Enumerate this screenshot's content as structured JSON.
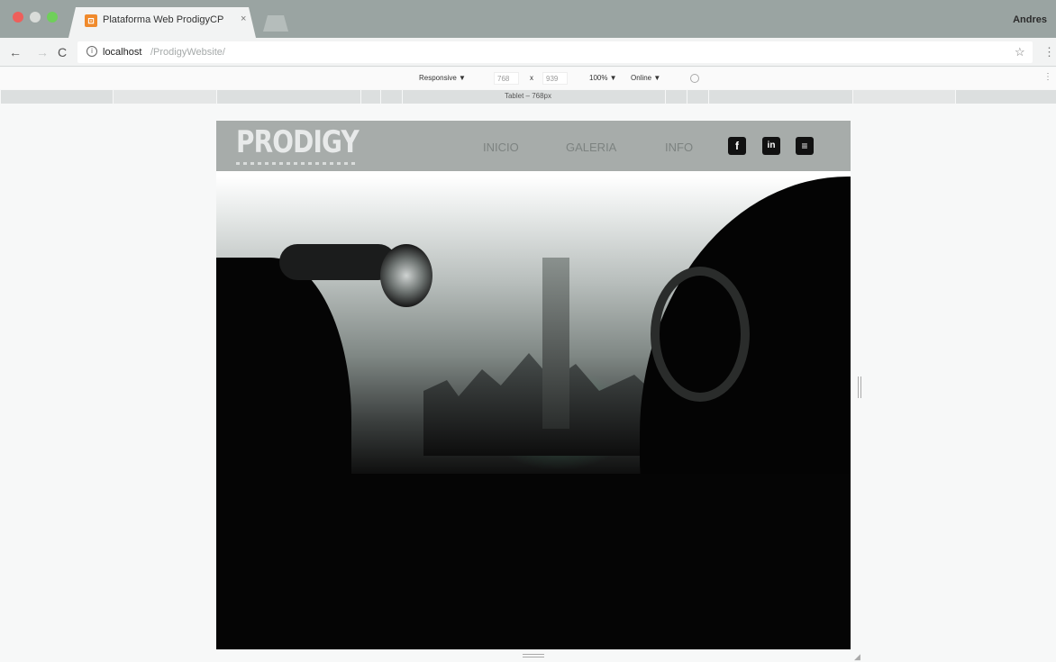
{
  "browser": {
    "tab_title": "Plataforma Web ProdigyCP",
    "tab_close": "×",
    "profile_name": "Andres",
    "url_host": "localhost",
    "url_path": "/ProdigyWebsite/"
  },
  "nav_icons": {
    "back": "←",
    "forward": "→",
    "reload": "C",
    "info": "i",
    "star": "☆",
    "menu": "⋮"
  },
  "devtools": {
    "device_mode": "Responsive ▼",
    "width": "768",
    "times": "x",
    "height": "939",
    "zoom": "100% ▼",
    "network": "Online ▼",
    "more": "⋮",
    "media_query_label": "Tablet – 768px"
  },
  "site": {
    "logo": "PRODIGY",
    "nav": {
      "inicio": "INICIO",
      "galeria": "GALERIA",
      "info": "INFO"
    },
    "social": {
      "facebook": "f",
      "linkedin": "in",
      "rss": "≡"
    }
  }
}
